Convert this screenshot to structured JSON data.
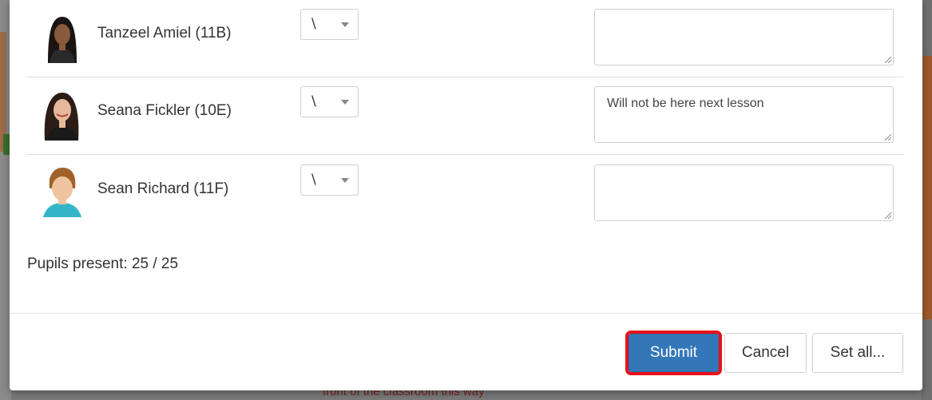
{
  "backdrop": {
    "bottom_text": "front of the classroom this way"
  },
  "students": [
    {
      "name": "Tanzeel Amiel (11B)",
      "status": "\\",
      "note": "",
      "avatar_icon": "student-photo"
    },
    {
      "name": "Seana Fickler (10E)",
      "status": "\\",
      "note": "Will not be here next lesson",
      "avatar_icon": "student-photo"
    },
    {
      "name": "Sean Richard (11F)",
      "status": "\\",
      "note": "",
      "avatar_icon": "student-photo"
    }
  ],
  "summary": {
    "pupils_present": "Pupils present: 25 / 25"
  },
  "footer": {
    "submit_label": "Submit",
    "cancel_label": "Cancel",
    "set_all_label": "Set all..."
  },
  "colors": {
    "submit_bg": "#3377b8",
    "highlight": "#e8111b"
  }
}
